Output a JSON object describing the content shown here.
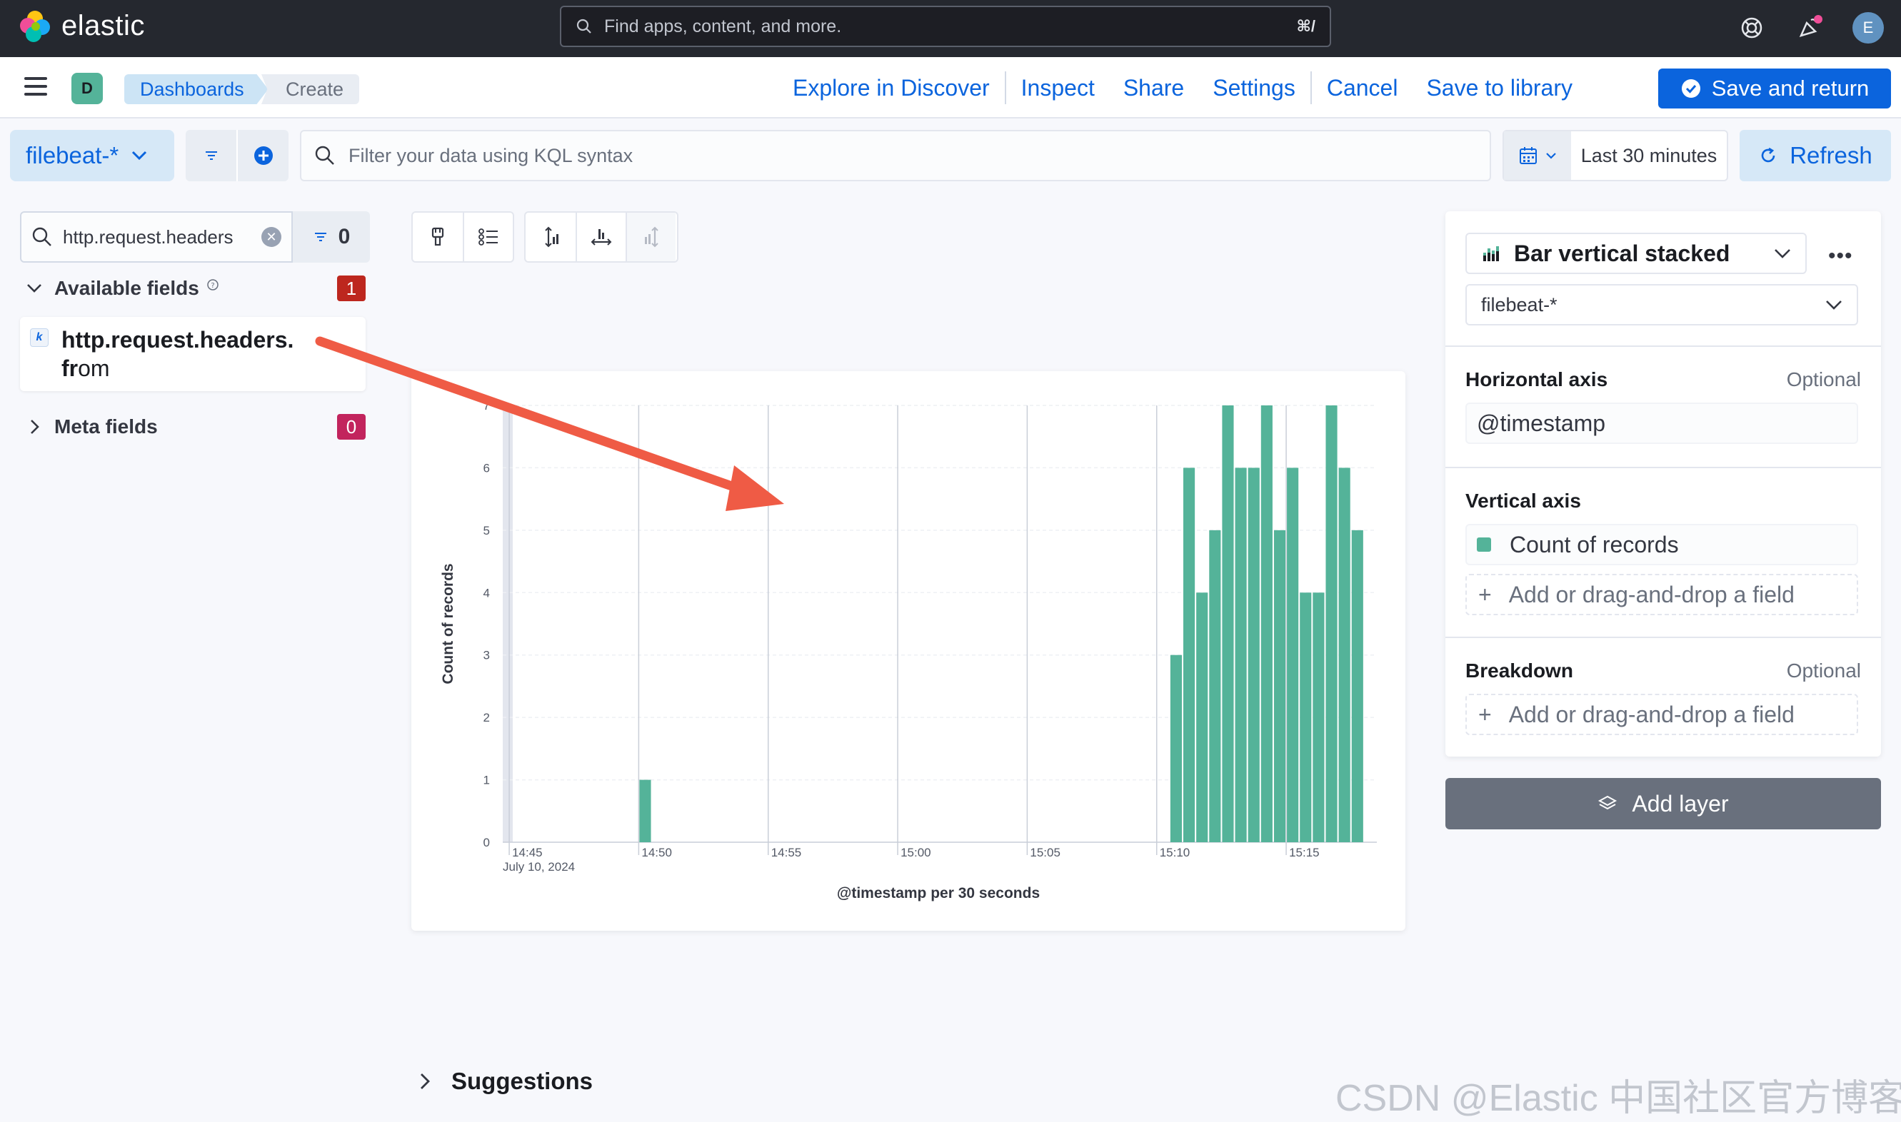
{
  "header": {
    "brand": "elastic",
    "search_placeholder": "Find apps, content, and more.",
    "search_shortcut": "⌘/",
    "avatar_initial": "E"
  },
  "subbar": {
    "space_initial": "D",
    "breadcrumbs": [
      "Dashboards",
      "Create"
    ],
    "links": [
      "Explore in Discover",
      "Inspect",
      "Share",
      "Settings",
      "Cancel",
      "Save to library"
    ],
    "primary_button": "Save and return"
  },
  "query": {
    "data_view": "filebeat-*",
    "kql_placeholder": "Filter your data using KQL syntax",
    "time_range": "Last 30 minutes",
    "refresh_label": "Refresh"
  },
  "fields": {
    "search_value": "http.request.headers",
    "filter_count": "0",
    "available_label": "Available fields",
    "available_count": "1",
    "field_name_bold": "http.request.headers.",
    "field_name_bold2": "fr",
    "field_name_rest": "om",
    "meta_label": "Meta fields",
    "meta_count": "0"
  },
  "suggestions_label": "Suggestions",
  "config": {
    "chart_type": "Bar vertical stacked",
    "layer_data_view": "filebeat-*",
    "horizontal_axis": {
      "title": "Horizontal axis",
      "optional": "Optional",
      "value": "@timestamp"
    },
    "vertical_axis": {
      "title": "Vertical axis",
      "value": "Count of records",
      "add": "Add or drag-and-drop a field"
    },
    "breakdown": {
      "title": "Breakdown",
      "optional": "Optional",
      "add": "Add or drag-and-drop a field"
    },
    "add_layer": "Add layer"
  },
  "watermark": "CSDN @Elastic 中国社区官方博客",
  "colors": {
    "accent": "#0b64dd",
    "series": "#54b399",
    "header_bg": "#25282f"
  },
  "chart_data": {
    "type": "bar",
    "ylabel": "Count of records",
    "xlabel": "@timestamp per 30 seconds",
    "x_date_label": "July 10, 2024",
    "x_ticks": [
      "14:45",
      "14:50",
      "14:55",
      "15:00",
      "15:05",
      "15:10",
      "15:15"
    ],
    "ylim": [
      0,
      7
    ],
    "y_ticks": [
      0,
      1,
      2,
      3,
      4,
      5,
      6,
      7
    ],
    "series": [
      {
        "values": [
          {
            "t": "14:50:00",
            "v": 1
          },
          {
            "t": "15:10:30",
            "v": 3
          },
          {
            "t": "15:11:00",
            "v": 6
          },
          {
            "t": "15:11:30",
            "v": 4
          },
          {
            "t": "15:12:00",
            "v": 5
          },
          {
            "t": "15:12:30",
            "v": 7
          },
          {
            "t": "15:13:00",
            "v": 6
          },
          {
            "t": "15:13:30",
            "v": 6
          },
          {
            "t": "15:14:00",
            "v": 7
          },
          {
            "t": "15:14:30",
            "v": 5
          },
          {
            "t": "15:15:00",
            "v": 6
          },
          {
            "t": "15:15:30",
            "v": 4
          },
          {
            "t": "15:16:00",
            "v": 4
          },
          {
            "t": "15:16:30",
            "v": 7
          },
          {
            "t": "15:17:00",
            "v": 6
          },
          {
            "t": "15:17:30",
            "v": 5
          }
        ]
      }
    ],
    "grid": true
  }
}
